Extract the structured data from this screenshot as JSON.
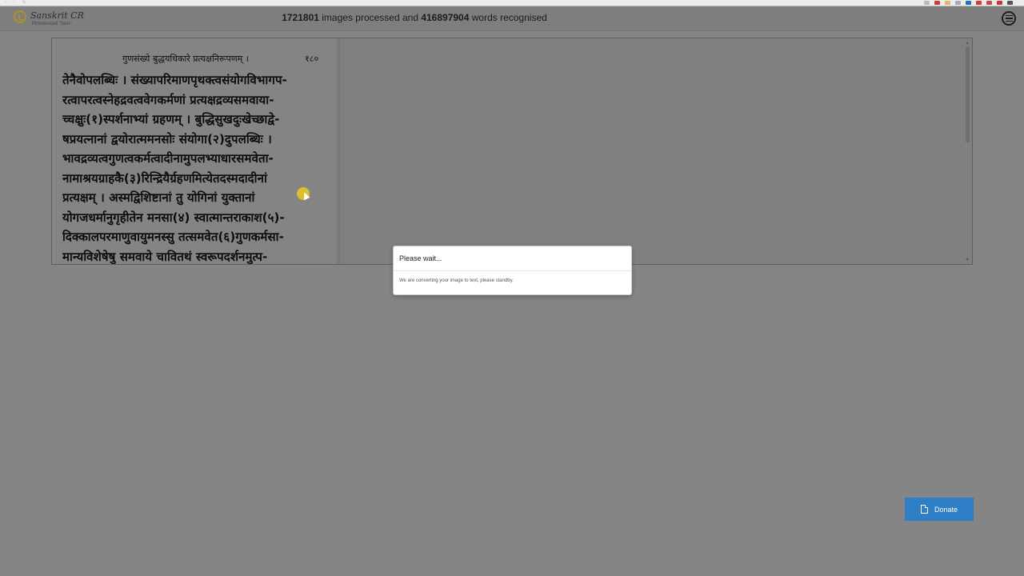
{
  "header": {
    "logo_name": "Sanskrit CR",
    "logo_sub": "Pronounced 'Seer'",
    "images_count": "1721801",
    "images_text": " images processed and ",
    "words_count": "416897904",
    "words_text": " words recognised"
  },
  "scan": {
    "heading": "गुणसंख्ये बुद्धयधिकारे प्रत्यक्षनिरूपणम् ।",
    "page_number": "१८०",
    "lines": [
      "तेनैवोपलब्धिः । संख्यापरिमाणपृथक्त्वसंयोगविभागप-",
      "रत्वापरत्वस्नेहद्रवत्ववेगकर्मणां प्रत्यक्षद्रव्यसमवाया-",
      "च्चक्षुः(१)स्पर्शनाभ्यां ग्रहणम् । बुद्धिसुखदुःखेच्छाद्वे-",
      "षप्रयत्नानां द्वयोरात्ममनसोः संयोगा(२)दुपलब्धिः ।",
      "भावद्रव्यत्वगुणत्वकर्मत्वादीनामुपलभ्याधारसमवेता-",
      "नामाश्रयग्राहकै(३)रिन्द्रियैर्ग्रहणमित्येतदस्मदादीनां",
      "प्रत्यक्षम् । अस्मद्विशिष्टानां तु योगिनां युक्तानां",
      "योगजधर्मानुगृहीतेन मनसा(४) स्वात्मान्तराकाश(५)-",
      "दिक्कालपरमाणुवायुमनस्सु तत्समवेत(६)गुणकर्मसा-",
      "मान्यविशेषेषु समवाये चावितथं स्वरूपदर्शनमुत्प-"
    ]
  },
  "modal": {
    "title": "Please wait...",
    "body": "We are converting your image to text, please standby."
  },
  "donate": {
    "label": "Donate"
  }
}
